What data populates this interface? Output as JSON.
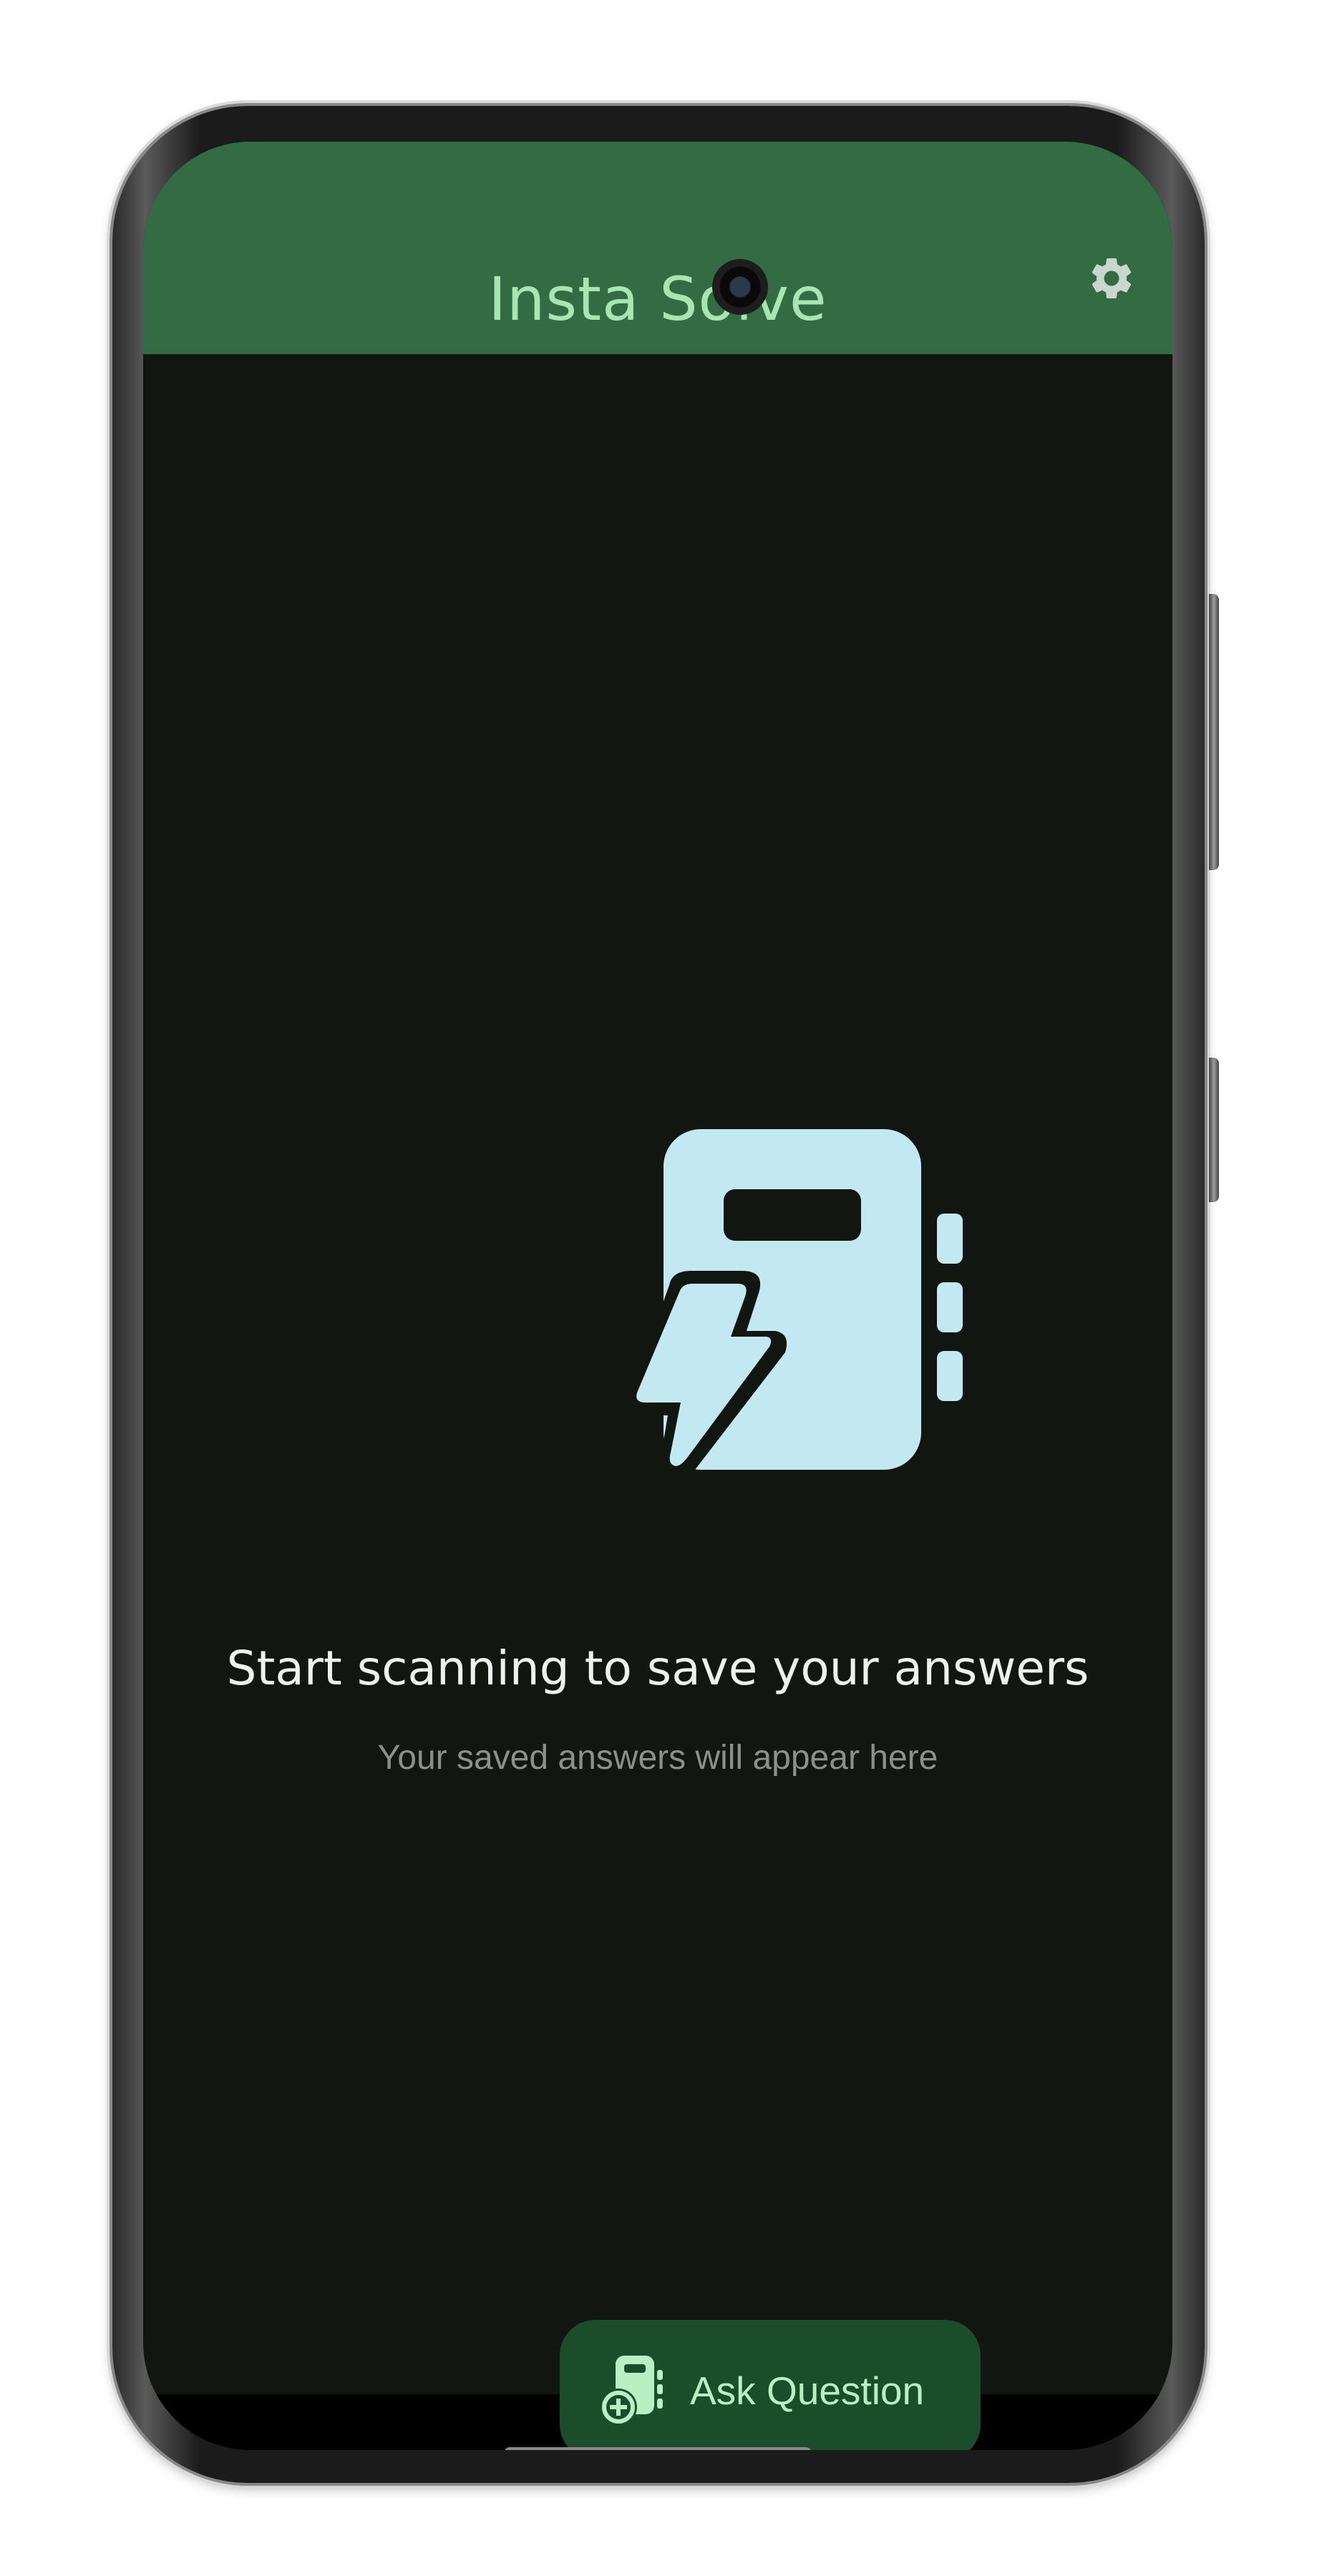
{
  "app_bar": {
    "title": "Insta Solve",
    "settings_icon": "gear-icon"
  },
  "empty_state": {
    "icon": "notebook-lightning-icon",
    "headline": "Start scanning to save your answers",
    "subtext": "Your saved answers will appear here"
  },
  "fab": {
    "label": "Ask Question",
    "icon": "notebook-add-icon"
  },
  "colors": {
    "app_bar": "#336b43",
    "title": "#a7e5b1",
    "background": "#111611",
    "icon": "#c2e8f1",
    "fab_bg": "#1c4d2b",
    "fab_text": "#b9f0c3"
  }
}
